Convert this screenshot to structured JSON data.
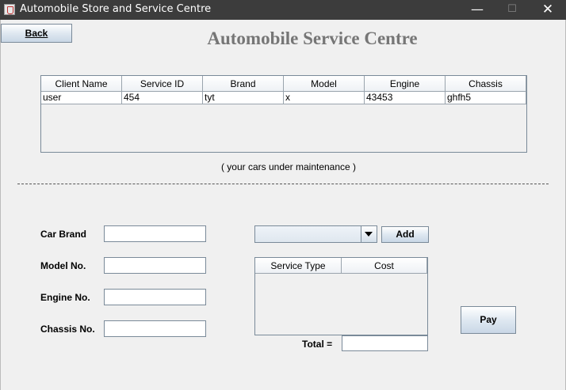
{
  "window": {
    "title": "Automobile Store and Service Centre",
    "minimize_glyph": "—",
    "maximize_glyph": "☐",
    "close_glyph": "✕"
  },
  "toolbar": {
    "back_label": "Back"
  },
  "heading": "Automobile Service Centre",
  "cars_table": {
    "columns": [
      "Client Name",
      "Service ID",
      "Brand",
      "Model",
      "Engine",
      "Chassis"
    ],
    "rows": [
      [
        "user",
        "454",
        "tyt",
        "x",
        "43453",
        "ghfh5"
      ]
    ]
  },
  "cars_caption": "( your cars under maintenance )",
  "form": {
    "car_brand_label": "Car  Brand",
    "model_label": "Model No.",
    "engine_label": "Engine No.",
    "chassis_label": "Chassis No.",
    "car_brand_value": "",
    "model_value": "",
    "engine_value": "",
    "chassis_value": ""
  },
  "service": {
    "combo_selected": "",
    "add_label": "Add",
    "columns": [
      "Service  Type",
      "Cost"
    ],
    "rows": []
  },
  "total": {
    "label": "Total  =",
    "value": ""
  },
  "pay_label": "Pay",
  "colors": {
    "titlebar": "#3c3c3c",
    "background": "#f0f0f0",
    "heading": "#767676",
    "border": "#7a8a99"
  }
}
